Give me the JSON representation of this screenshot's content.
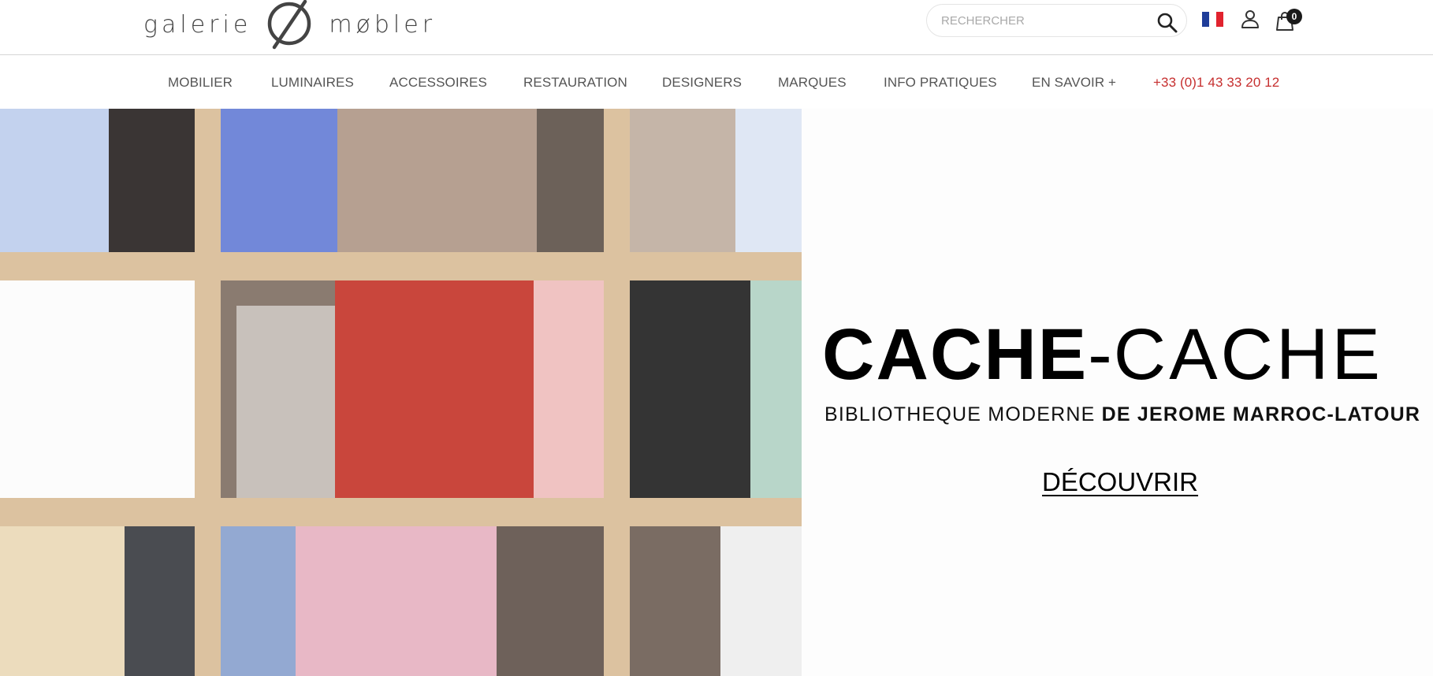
{
  "brand": {
    "name_left": "galerie",
    "name_right": "møbler",
    "logo_icon": "slashed-circle-logo-icon"
  },
  "header": {
    "search": {
      "placeholder": "RECHERCHER",
      "value": "",
      "icon": "search-icon"
    },
    "language": {
      "icon": "flag-fr-icon",
      "colors": [
        "#1f3d99",
        "#ffffff",
        "#e1232e"
      ]
    },
    "account": {
      "icon": "user-icon"
    },
    "cart": {
      "icon": "shopping-bag-icon",
      "count": "0"
    }
  },
  "nav": {
    "items": [
      {
        "label": "MOBILIER"
      },
      {
        "label": "LUMINAIRES"
      },
      {
        "label": "ACCESSOIRES"
      },
      {
        "label": "RESTAURATION"
      },
      {
        "label": "DESIGNERS"
      },
      {
        "label": "MARQUES"
      },
      {
        "label": "INFO PRATIQUES"
      },
      {
        "label": "EN SAVOIR +"
      }
    ],
    "phone": "+33 (0)1 43 33 20 12"
  },
  "hero": {
    "title_part1": "CACHE",
    "title_separator": "-",
    "title_part2": "CACHE",
    "subtitle_part1": "BIBLIOTHEQUE MODERNE ",
    "subtitle_part2": "DE JEROME MARROC-LATOUR",
    "cta": "DÉCOUVRIR",
    "image": "bookshelf-photo"
  },
  "colors": {
    "phone": "#c62f2f",
    "wood": "#dcc2a0",
    "text": "#333333"
  }
}
